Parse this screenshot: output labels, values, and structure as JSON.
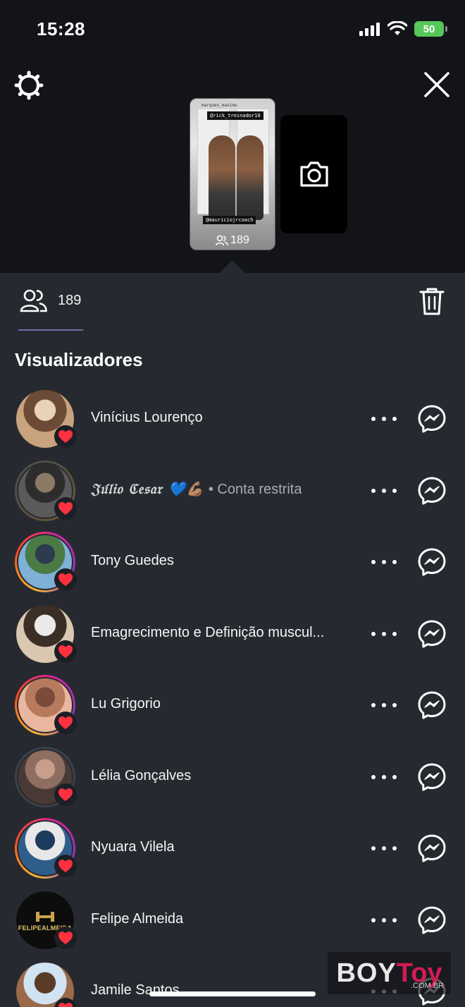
{
  "status_bar": {
    "time": "15:28",
    "battery": "50"
  },
  "story": {
    "thumb_tag_top": "@rick_treinador10",
    "thumb_tag_bottom": "@mauriciojrcoach",
    "thumb_username": "marques_maximo",
    "thumb_view_count": "189"
  },
  "tabs": {
    "viewers_count": "189"
  },
  "section_title": "Visualizadores",
  "viewers": [
    {
      "name": "Vinícius Lourenço",
      "ring": "none",
      "liked": true
    },
    {
      "name": "𝔍𝔲́𝔩𝔦𝔬 ℭ𝔢𝔰𝔞𝔯 💙💪🏽",
      "suffix": " • Conta restrita",
      "ring": "dark",
      "liked": true
    },
    {
      "name": "Tony Guedes",
      "ring": "story",
      "liked": true
    },
    {
      "name": "Emagrecimento e Definição muscul...",
      "ring": "none",
      "liked": true
    },
    {
      "name": "Lu Grigorio",
      "ring": "story",
      "liked": true
    },
    {
      "name": "Lélia Gonçalves",
      "ring": "seen",
      "liked": true
    },
    {
      "name": "Nyuara Vilela",
      "ring": "story",
      "liked": true
    },
    {
      "name": "Felipe Almeida",
      "ring": "none",
      "liked": true,
      "avatar_text": "FELIPEALMEIDA"
    },
    {
      "name": "Jamile Santos",
      "ring": "none",
      "liked": true
    }
  ],
  "watermark": {
    "boy": "BOY",
    "toy": "Toy",
    "sub": ".COM.BR"
  },
  "colors": {
    "panel_bg": "#262a30",
    "top_bg": "#121418",
    "heart": "#ff3040",
    "tab_underline": "#6a6fa8"
  }
}
